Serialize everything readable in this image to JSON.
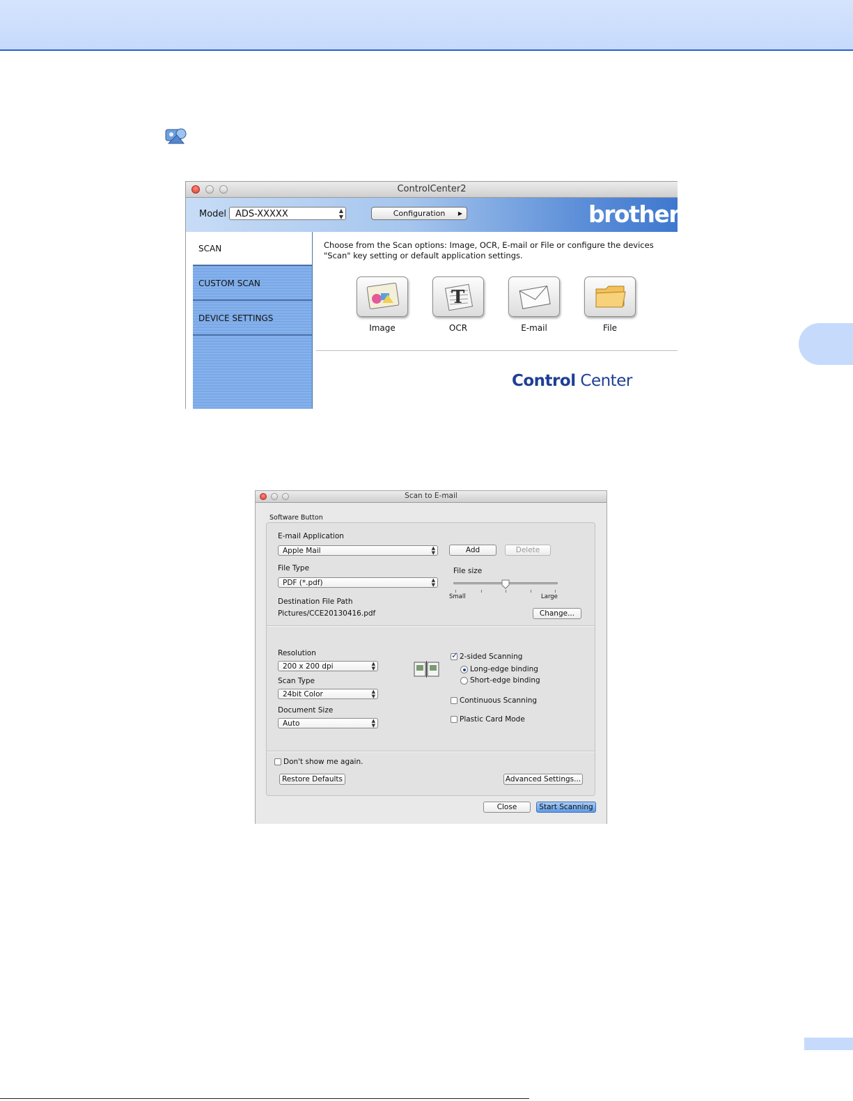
{
  "controlcenter": {
    "title": "ControlCenter2",
    "model_label": "Model",
    "model_value": "ADS-XXXXX",
    "configuration_label": "Configuration",
    "brand_logo": "brother",
    "sidebar": [
      {
        "label": "SCAN",
        "active": true
      },
      {
        "label": "CUSTOM SCAN",
        "active": false
      },
      {
        "label": "DEVICE SETTINGS",
        "active": false
      }
    ],
    "description_line1": "Choose from the Scan options: Image, OCR, E-mail or File or configure the devices",
    "description_line2": "\"Scan\" key setting or default application settings.",
    "scan_buttons": [
      {
        "label": "Image",
        "icon": "image-icon"
      },
      {
        "label": "OCR",
        "icon": "ocr-icon"
      },
      {
        "label": "E-mail",
        "icon": "envelope-icon"
      },
      {
        "label": "File",
        "icon": "folder-icon"
      }
    ],
    "footer_brand_bold": "Control",
    "footer_brand_regular": " Center"
  },
  "dialog": {
    "title": "Scan to E-mail",
    "group_label": "Software Button",
    "email_app_label": "E-mail Application",
    "email_app_value": "Apple Mail",
    "add_label": "Add",
    "delete_label": "Delete",
    "file_type_label": "File Type",
    "file_type_value": "PDF (*.pdf)",
    "file_size_label": "File size",
    "file_size_min": "Small",
    "file_size_max": "Large",
    "file_size_level": 0.5,
    "dest_path_label": "Destination File Path",
    "dest_path_value": "Pictures/CCE20130416.pdf",
    "change_label": "Change...",
    "resolution_label": "Resolution",
    "resolution_value": "200 x 200 dpi",
    "scan_type_label": "Scan Type",
    "scan_type_value": "24bit Color",
    "doc_size_label": "Document Size",
    "doc_size_value": "Auto",
    "two_sided_label": "2-sided Scanning",
    "two_sided_checked": true,
    "long_edge_label": "Long-edge binding",
    "short_edge_label": "Short-edge binding",
    "continuous_label": "Continuous Scanning",
    "plastic_card_label": "Plastic Card Mode",
    "dont_show_label": "Don't show me again.",
    "restore_defaults_label": "Restore Defaults",
    "advanced_settings_label": "Advanced Settings...",
    "close_label": "Close",
    "start_scanning_label": "Start Scanning"
  },
  "colors": {
    "header_bg": "#c6dafc",
    "header_rule": "#2b5fc7",
    "toolbar_blue": "#3f78cf",
    "sidebar_blue": "#7aa8e6",
    "brand_navy": "#1f3f94",
    "primary_button": "#5f9ae6"
  }
}
